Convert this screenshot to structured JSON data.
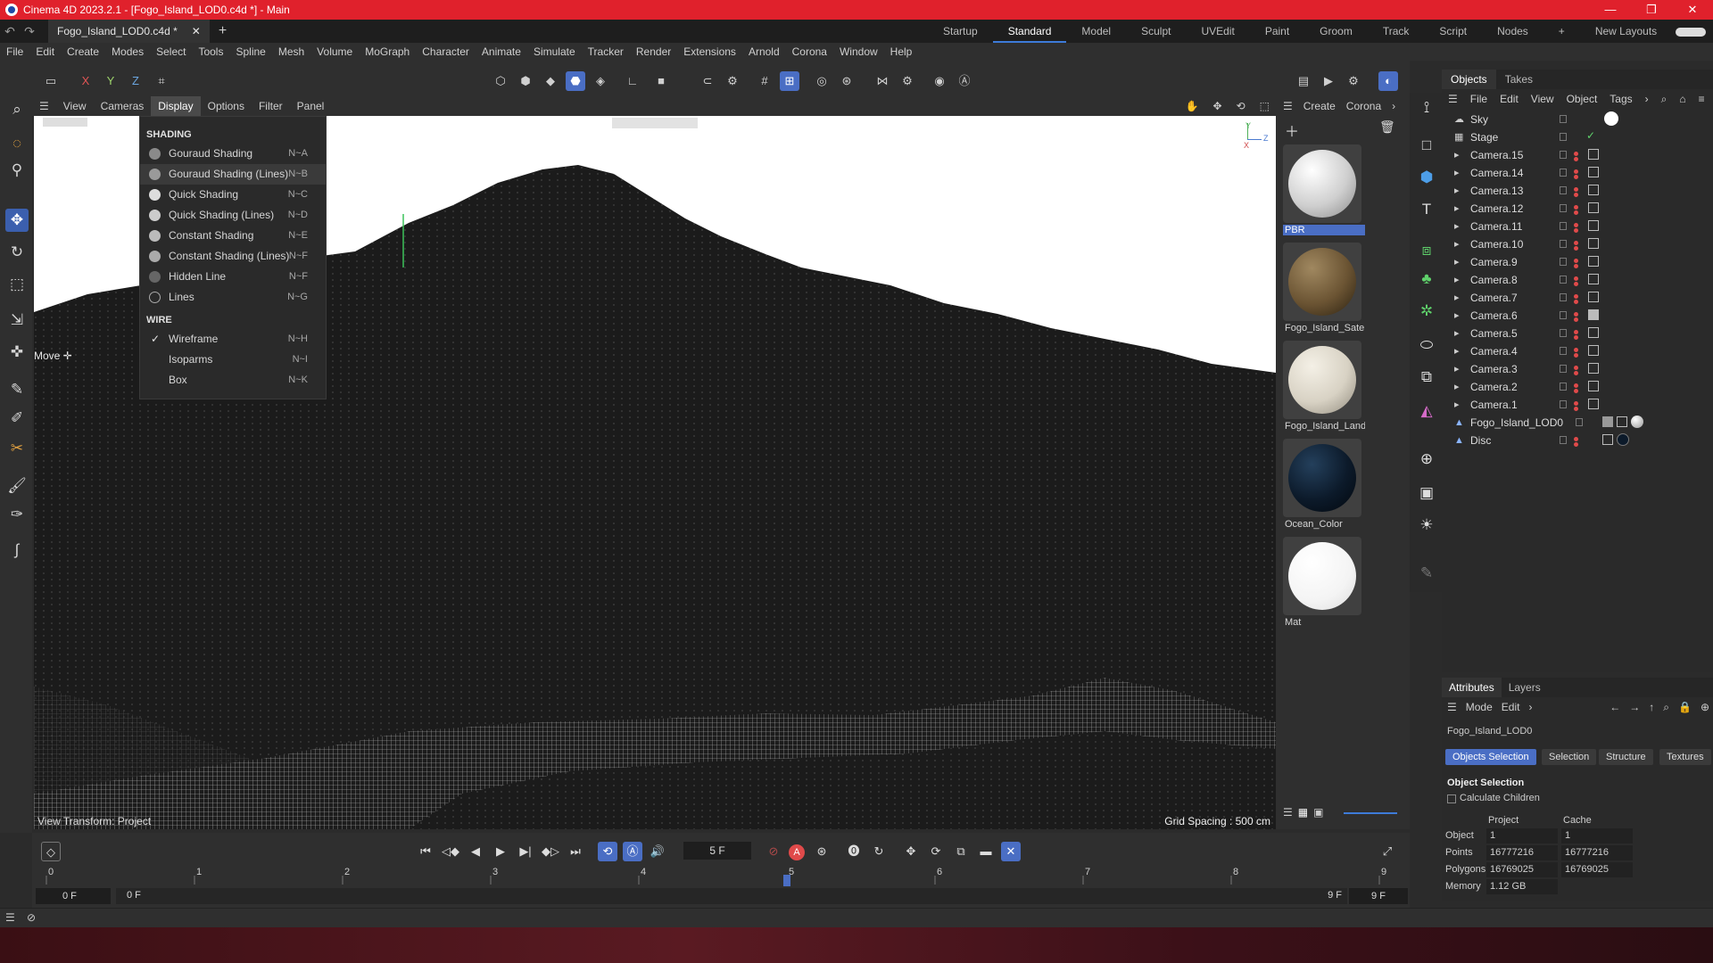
{
  "window": {
    "title": "Cinema 4D 2023.2.1 - [Fogo_Island_LOD0.c4d *] - Main",
    "controls": [
      "—",
      "❐",
      "✕"
    ]
  },
  "tabs": {
    "doc_tab": "Fogo_Island_LOD0.c4d *",
    "close": "✕",
    "add": "+"
  },
  "layouts": {
    "items": [
      "Startup",
      "Standard",
      "Model",
      "Sculpt",
      "UVEdit",
      "Paint",
      "Groom",
      "Track",
      "Script",
      "Nodes"
    ],
    "active": "Standard",
    "add": "+",
    "new_layouts": "New Layouts"
  },
  "menubar": [
    "File",
    "Edit",
    "Create",
    "Modes",
    "Select",
    "Tools",
    "Spline",
    "Mesh",
    "Volume",
    "MoGraph",
    "Character",
    "Animate",
    "Simulate",
    "Tracker",
    "Render",
    "Extensions",
    "Arnold",
    "Corona",
    "Window",
    "Help"
  ],
  "axis_toggles": [
    "X",
    "Y",
    "Z"
  ],
  "viewport": {
    "menu": [
      "View",
      "Cameras",
      "Display",
      "Options",
      "Filter",
      "Panel"
    ],
    "active_menu": "Display",
    "tooltip": "Move",
    "bottom_left": "View Transform: Project",
    "bottom_right": "Grid Spacing : 500 cm",
    "axis": {
      "y": "Y",
      "x": "X",
      "z": "Z"
    }
  },
  "display_menu": {
    "shading_header": "SHADING",
    "shading": [
      {
        "label": "Gouraud Shading",
        "shortcut": "N~A"
      },
      {
        "label": "Gouraud Shading (Lines)",
        "shortcut": "N~B"
      },
      {
        "label": "Quick Shading",
        "shortcut": "N~C"
      },
      {
        "label": "Quick Shading (Lines)",
        "shortcut": "N~D"
      },
      {
        "label": "Constant Shading",
        "shortcut": "N~E"
      },
      {
        "label": "Constant Shading (Lines)",
        "shortcut": "N~F"
      },
      {
        "label": "Hidden Line",
        "shortcut": "N~F"
      },
      {
        "label": "Lines",
        "shortcut": "N~G"
      }
    ],
    "selected_shading": "Gouraud Shading (Lines)",
    "wire_header": "WIRE",
    "wire": [
      {
        "label": "Wireframe",
        "shortcut": "N~H",
        "checked": true
      },
      {
        "label": "Isoparms",
        "shortcut": "N~I",
        "checked": false
      },
      {
        "label": "Box",
        "shortcut": "N~K",
        "checked": false
      }
    ]
  },
  "materials": {
    "menu": [
      "Create",
      "Corona"
    ],
    "items": [
      {
        "name": "PBR",
        "color": "#e8e8e8",
        "selected": true
      },
      {
        "name": "Fogo_Island_Satel",
        "color": "#6b5433"
      },
      {
        "name": "Fogo_Island_Land",
        "color": "#d8d2c4"
      },
      {
        "name": "Ocean_Color",
        "color": "#0c1a2a"
      },
      {
        "name": "Mat",
        "color": "#ffffff"
      }
    ]
  },
  "objects": {
    "tabs": [
      "Objects",
      "Takes"
    ],
    "active_tab": "Objects",
    "menu": [
      "File",
      "Edit",
      "View",
      "Object",
      "Tags"
    ],
    "items": [
      {
        "name": "Sky",
        "icon": "sky-icon"
      },
      {
        "name": "Stage",
        "icon": "stage-icon"
      },
      {
        "name": "Camera.15",
        "icon": "camera-icon"
      },
      {
        "name": "Camera.14",
        "icon": "camera-icon"
      },
      {
        "name": "Camera.13",
        "icon": "camera-icon"
      },
      {
        "name": "Camera.12",
        "icon": "camera-icon"
      },
      {
        "name": "Camera.11",
        "icon": "camera-icon"
      },
      {
        "name": "Camera.10",
        "icon": "camera-icon"
      },
      {
        "name": "Camera.9",
        "icon": "camera-icon"
      },
      {
        "name": "Camera.8",
        "icon": "camera-icon"
      },
      {
        "name": "Camera.7",
        "icon": "camera-icon"
      },
      {
        "name": "Camera.6",
        "icon": "camera-icon"
      },
      {
        "name": "Camera.5",
        "icon": "camera-icon"
      },
      {
        "name": "Camera.4",
        "icon": "camera-icon"
      },
      {
        "name": "Camera.3",
        "icon": "camera-icon"
      },
      {
        "name": "Camera.2",
        "icon": "camera-icon"
      },
      {
        "name": "Camera.1",
        "icon": "camera-icon"
      },
      {
        "name": "Fogo_Island_LOD0",
        "icon": "mesh-icon"
      },
      {
        "name": "Disc",
        "icon": "disc-icon"
      }
    ]
  },
  "attributes": {
    "tabs": [
      "Attributes",
      "Layers"
    ],
    "active_tab": "Attributes",
    "menu": [
      "Mode",
      "Edit"
    ],
    "object_name": "Fogo_Island_LOD0",
    "subtabs": [
      "Objects Selection",
      "Selection",
      "Structure",
      "Textures"
    ],
    "active_subtab": "Objects Selection",
    "section": "Object Selection",
    "calc_children": "Calculate Children",
    "columns": [
      "Project",
      "Cache"
    ],
    "rows": [
      {
        "label": "Object",
        "project": "1",
        "cache": "1"
      },
      {
        "label": "Points",
        "project": "16777216",
        "cache": "16777216"
      },
      {
        "label": "Polygons",
        "project": "16769025",
        "cache": "16769025"
      },
      {
        "label": "Memory",
        "project": "1.12 GB",
        "cache": ""
      }
    ]
  },
  "timeline": {
    "current_frame": "5 F",
    "ruler": [
      "0",
      "1",
      "2",
      "3",
      "4",
      "5",
      "6",
      "7",
      "8",
      "9"
    ],
    "playhead": 5,
    "max_frame": 9,
    "start": "0 F",
    "range_start": "0 F",
    "range_end": "9 F",
    "end": "9 F",
    "record": "A"
  }
}
